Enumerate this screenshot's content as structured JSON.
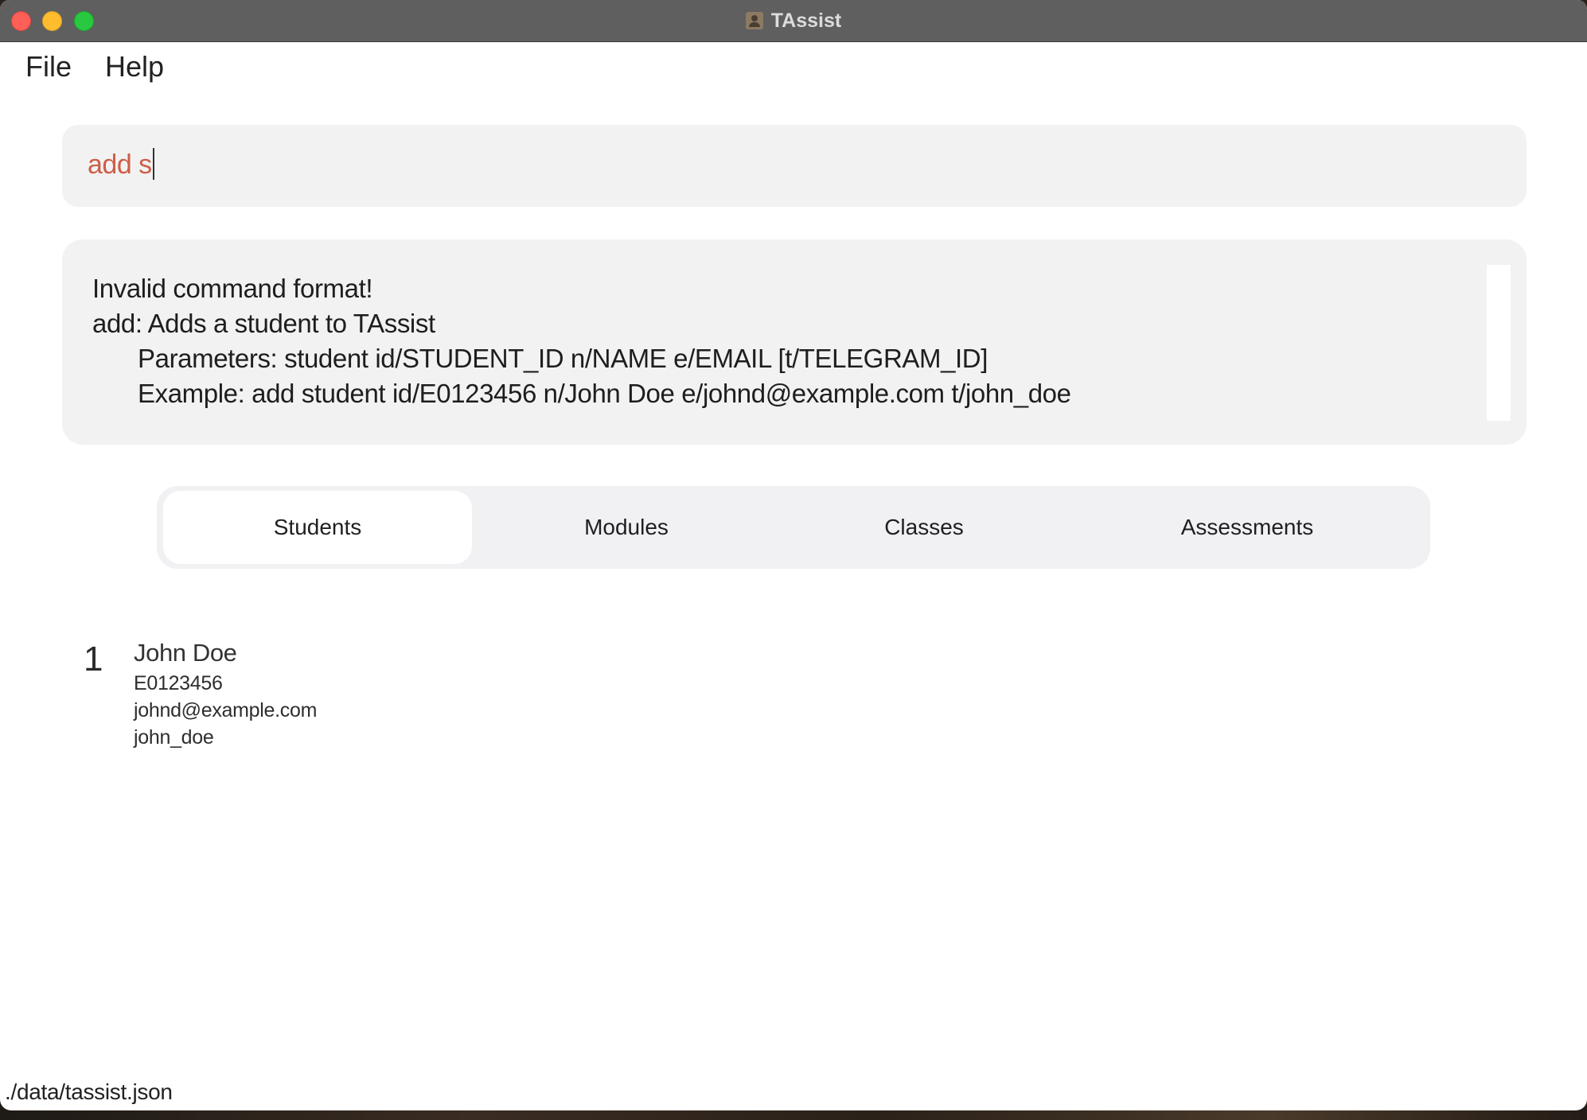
{
  "window": {
    "title": "TAssist"
  },
  "menu": {
    "items": [
      "File",
      "Help"
    ]
  },
  "command": {
    "value": "add s"
  },
  "result": {
    "lines": [
      "Invalid command format!",
      "add: Adds a student to TAssist",
      "Parameters: student id/STUDENT_ID n/NAME e/EMAIL [t/TELEGRAM_ID]",
      "Example: add student id/E0123456 n/John Doe e/johnd@example.com t/john_doe"
    ]
  },
  "tabs": {
    "items": [
      "Students",
      "Modules",
      "Classes",
      "Assessments"
    ],
    "active": "Students"
  },
  "students": [
    {
      "index": "1",
      "name": "John Doe",
      "student_id": "E0123456",
      "email": "johnd@example.com",
      "telegram": "john_doe"
    }
  ],
  "status": {
    "file_path": "./data/tassist.json"
  },
  "colors": {
    "titlebar": "#5f5f5f",
    "command_text": "#cf5d47",
    "panel_bg": "#f2f2f3",
    "tab_bar_bg": "#f1f1f4",
    "active_tab_bg": "#ffffff"
  }
}
